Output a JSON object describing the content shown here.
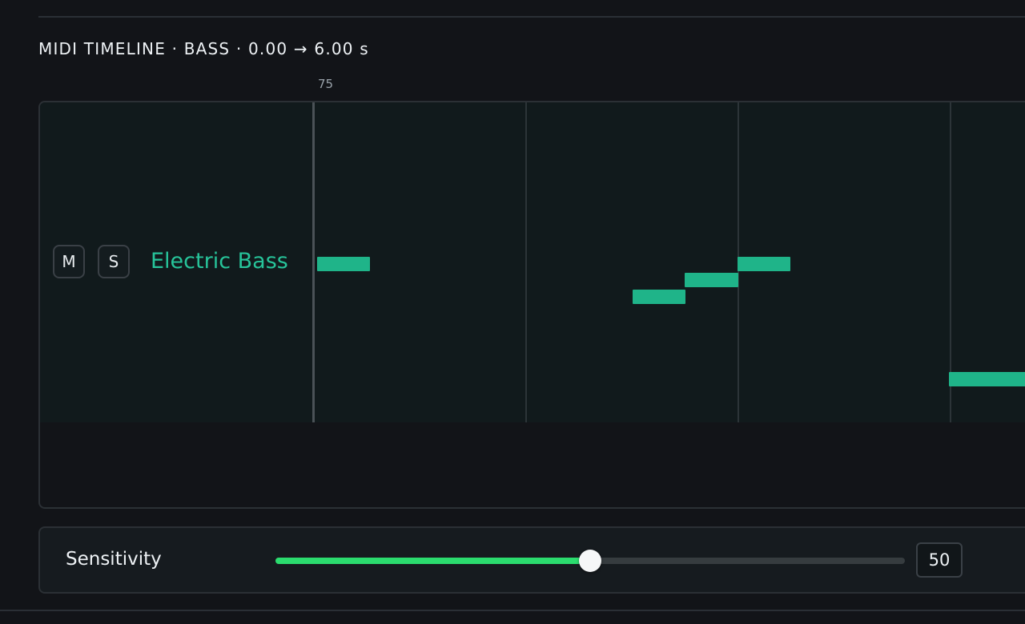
{
  "header": {
    "title": "MIDI TIMELINE · BASS · 0.00 → 6.00 s",
    "ruler_marker": "75"
  },
  "track": {
    "name": "Electric Bass",
    "mute_label": "M",
    "solo_label": "S",
    "color": "#1fb489"
  },
  "sensitivity": {
    "label": "Sensitivity",
    "value": "50",
    "slider_fraction": 0.5,
    "fill_color": "#2bdc6e"
  }
}
